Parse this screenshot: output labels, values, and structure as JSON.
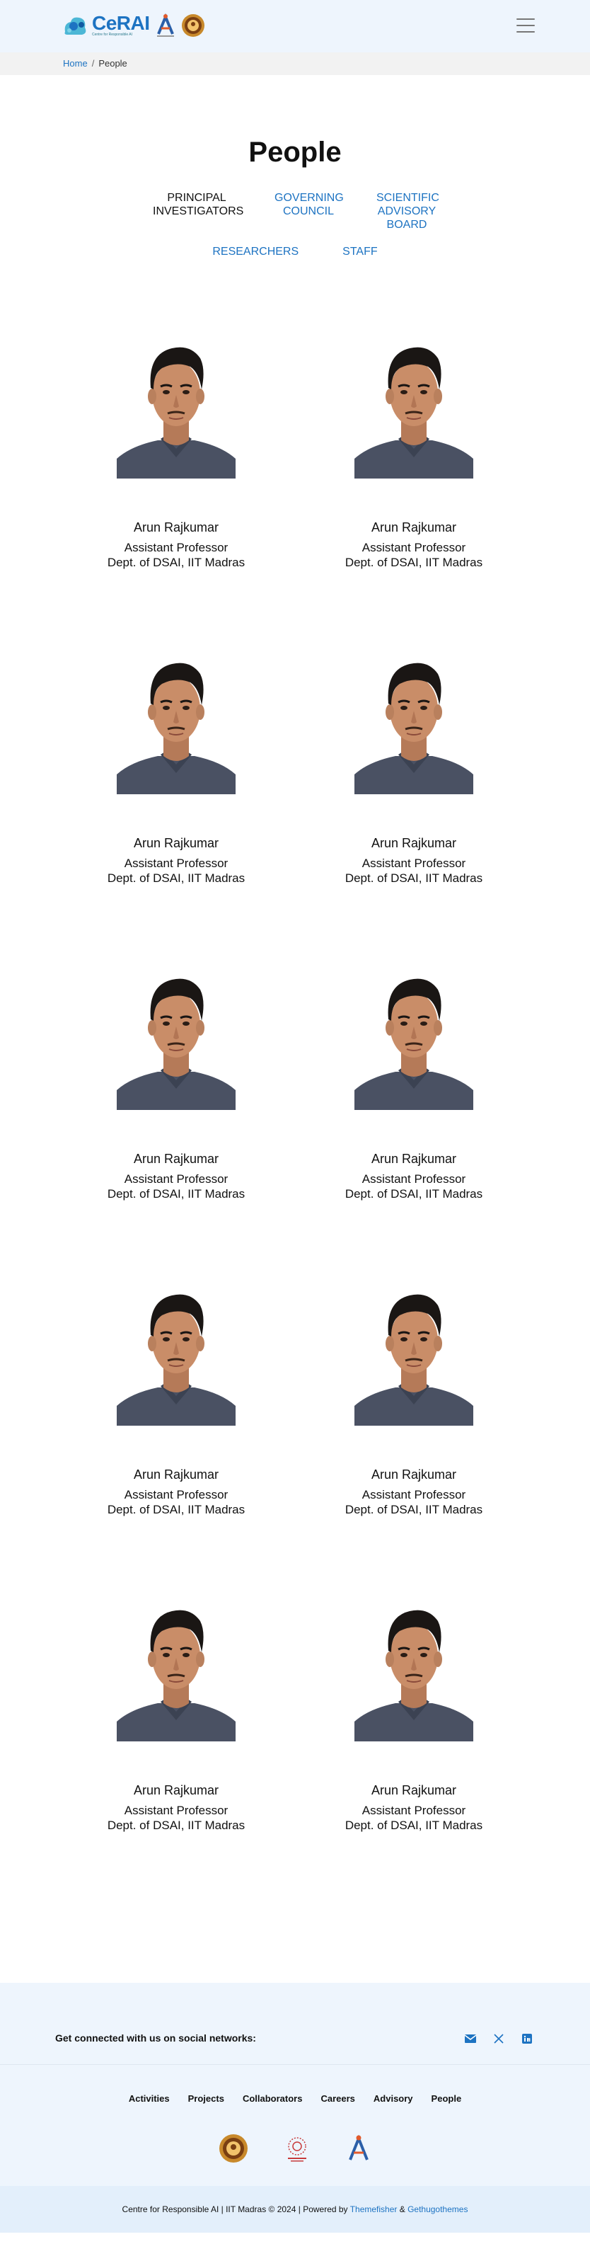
{
  "header": {
    "logo_word": "CeRAI",
    "logo_tagline": "Centre for Responsible AI",
    "menu_icon": "hamburger-menu-icon"
  },
  "breadcrumb": {
    "home": "Home",
    "separator": "/",
    "current": "People"
  },
  "page_title": "People",
  "tabs": [
    {
      "label": "PRINCIPAL\nINVESTIGATORS",
      "active": true
    },
    {
      "label": "GOVERNING\nCOUNCIL",
      "active": false
    },
    {
      "label": "SCIENTIFIC\nADVISORY\nBOARD",
      "active": false
    },
    {
      "label": "RESEARCHERS",
      "active": false
    },
    {
      "label": "STAFF",
      "active": false
    }
  ],
  "people": [
    {
      "name": "Arun Rajkumar",
      "role": "Assistant Professor",
      "dept": "Dept. of DSAI, IIT Madras"
    },
    {
      "name": "Arun Rajkumar",
      "role": "Assistant Professor",
      "dept": "Dept. of DSAI, IIT Madras"
    },
    {
      "name": "Arun Rajkumar",
      "role": "Assistant Professor",
      "dept": "Dept. of DSAI, IIT Madras"
    },
    {
      "name": "Arun Rajkumar",
      "role": "Assistant Professor",
      "dept": "Dept. of DSAI, IIT Madras"
    },
    {
      "name": "Arun Rajkumar",
      "role": "Assistant Professor",
      "dept": "Dept. of DSAI, IIT Madras"
    },
    {
      "name": "Arun Rajkumar",
      "role": "Assistant Professor",
      "dept": "Dept. of DSAI, IIT Madras"
    },
    {
      "name": "Arun Rajkumar",
      "role": "Assistant Professor",
      "dept": "Dept. of DSAI, IIT Madras"
    },
    {
      "name": "Arun Rajkumar",
      "role": "Assistant Professor",
      "dept": "Dept. of DSAI, IIT Madras"
    },
    {
      "name": "Arun Rajkumar",
      "role": "Assistant Professor",
      "dept": "Dept. of DSAI, IIT Madras"
    },
    {
      "name": "Arun Rajkumar",
      "role": "Assistant Professor",
      "dept": "Dept. of DSAI, IIT Madras"
    }
  ],
  "footer": {
    "social_text": "Get connected with us on social networks:",
    "social_icons": [
      "email-icon",
      "x-twitter-icon",
      "linkedin-icon"
    ],
    "links": [
      "Activities",
      "Projects",
      "Collaborators",
      "Careers",
      "Advisory",
      "People"
    ],
    "logos": [
      "iit-madras-logo",
      "wadhwani-school-logo",
      "cerai-a-logo"
    ],
    "copyright": "Centre for Responsible AI | IIT Madras © 2024 | Powered by ",
    "themefisher": "Themefisher",
    "amp": " & ",
    "gethugothemes": "Gethugothemes"
  },
  "colors": {
    "accent": "#1d73c2",
    "header_bg": "#eef5fd",
    "breadcrumb_bg": "#f2f2f2",
    "footer_bottom_bg": "#e3effb"
  }
}
